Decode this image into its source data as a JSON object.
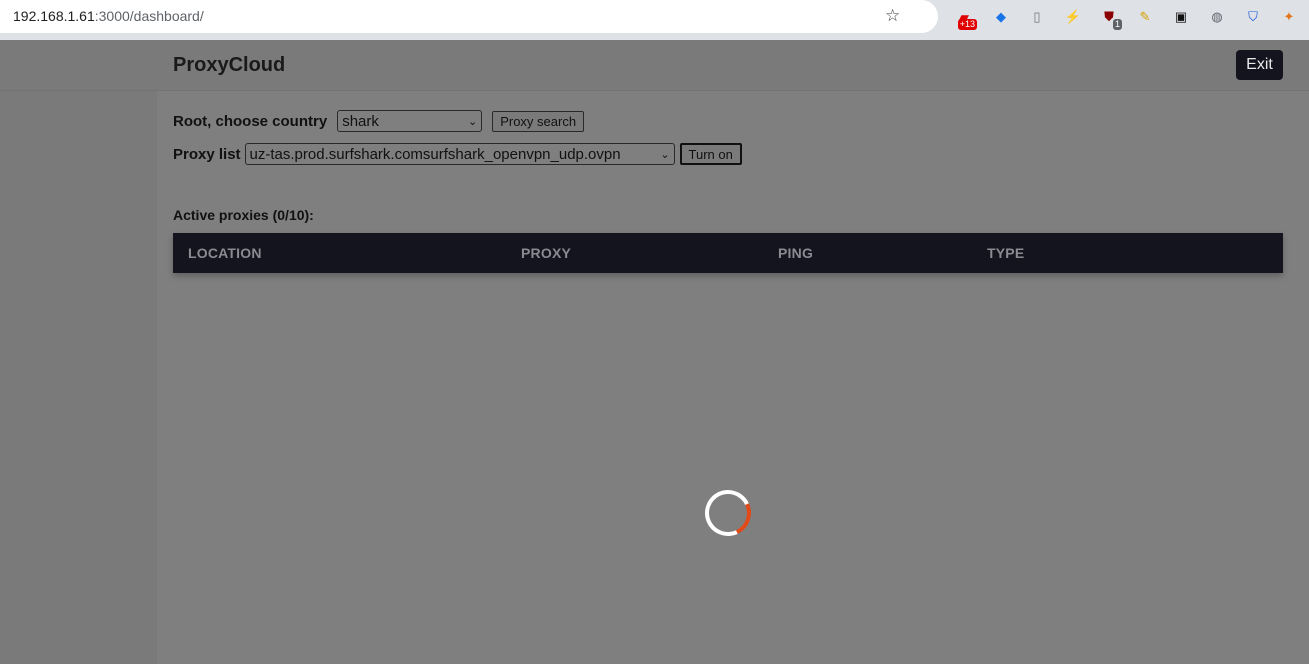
{
  "browser": {
    "url_host": "192.168.1.61",
    "url_rest": ":3000/dashboard/",
    "extensions": [
      {
        "name": "ext-counter-icon",
        "glyph": "▰",
        "badge": "+13",
        "color": "#e00000"
      },
      {
        "name": "ext-diamond-icon",
        "glyph": "◆",
        "badge": "",
        "color": "#1a73e8"
      },
      {
        "name": "ext-page-icon",
        "glyph": "▯",
        "badge": "",
        "color": "#777777"
      },
      {
        "name": "ext-bolt-icon",
        "glyph": "⚡",
        "badge": "",
        "color": "#202124"
      },
      {
        "name": "ext-ublock-icon",
        "glyph": "⛊",
        "badge": "1",
        "color": "#8b0000"
      },
      {
        "name": "ext-broom-icon",
        "glyph": "✎",
        "badge": "",
        "color": "#d4a000"
      },
      {
        "name": "ext-mask-icon",
        "glyph": "▣",
        "badge": "",
        "color": "#111111"
      },
      {
        "name": "ext-planet-icon",
        "glyph": "◍",
        "badge": "",
        "color": "#5f6368"
      },
      {
        "name": "ext-shield-icon",
        "glyph": "⛉",
        "badge": "",
        "color": "#1a56db"
      },
      {
        "name": "ext-fox-icon",
        "glyph": "✦",
        "badge": "",
        "color": "#e2761b"
      }
    ]
  },
  "header": {
    "brand": "ProxyCloud",
    "exit_label": "Exit"
  },
  "controls": {
    "country_label": "Root, choose country",
    "country_value": "shark",
    "search_label": "Proxy search",
    "proxy_list_label": "Proxy list",
    "proxy_list_value": "uz-tas.prod.surfshark.comsurfshark_openvpn_udp.ovpn",
    "turn_on_label": "Turn on"
  },
  "active": {
    "title": "Active proxies (0/10):",
    "columns": [
      "LOCATION",
      "PROXY",
      "PING",
      "TYPE"
    ]
  },
  "colors": {
    "accent": "#e24a18",
    "header_bg": "#14141f"
  }
}
